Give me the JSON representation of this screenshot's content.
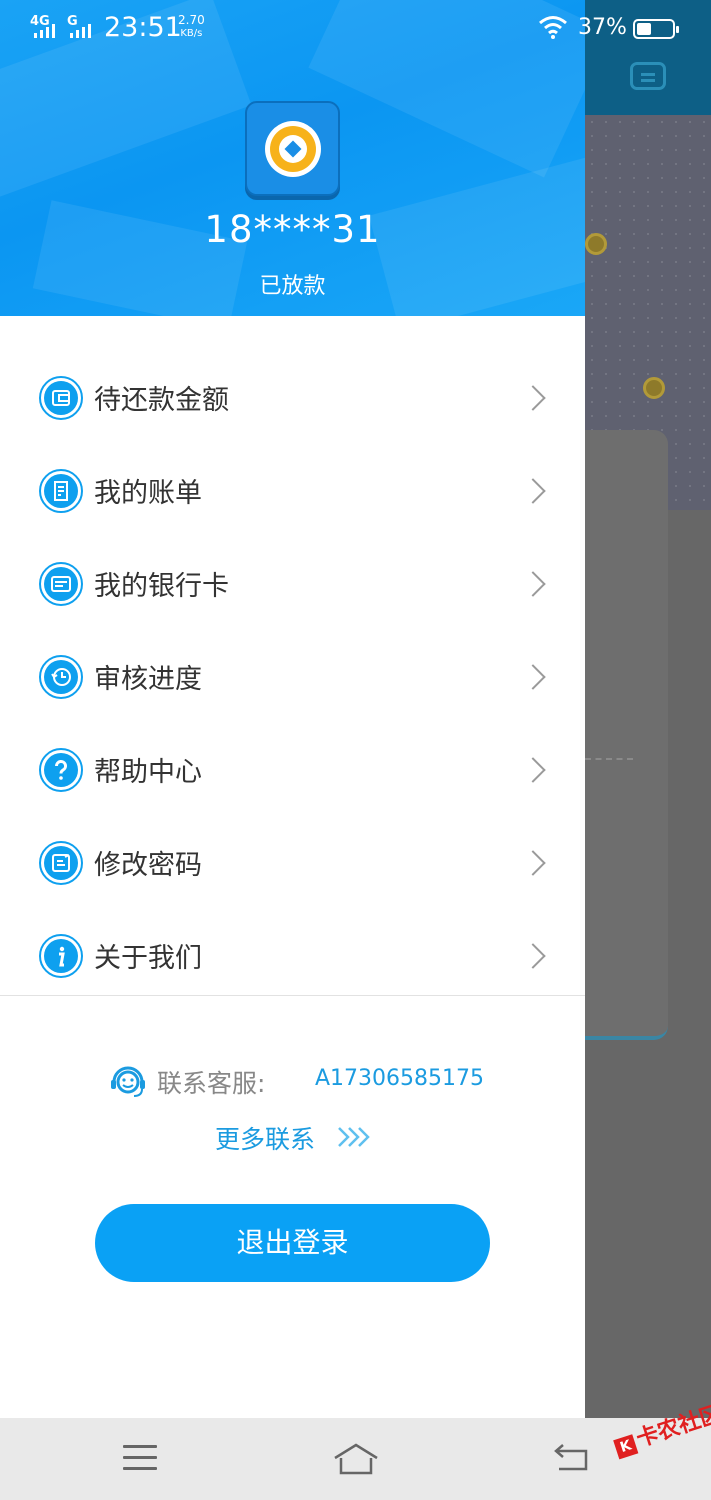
{
  "status_bar": {
    "network_1": "4G",
    "network_2": "G",
    "time": "23:51",
    "speed_value": "2.70",
    "speed_unit": "KB/s",
    "battery": "37%"
  },
  "profile": {
    "phone": "18****31",
    "status": "已放款"
  },
  "menu": {
    "items": [
      {
        "label": "待还款金额",
        "icon": "wallet-icon"
      },
      {
        "label": "我的账单",
        "icon": "bill-icon"
      },
      {
        "label": "我的银行卡",
        "icon": "bank-card-icon"
      },
      {
        "label": "审核进度",
        "icon": "history-icon"
      },
      {
        "label": "帮助中心",
        "icon": "help-icon"
      },
      {
        "label": "修改密码",
        "icon": "edit-password-icon"
      },
      {
        "label": "关于我们",
        "icon": "info-icon"
      }
    ]
  },
  "customer_service": {
    "label": "联系客服:",
    "value": "A17306585175",
    "more_label": "更多联系"
  },
  "logout": {
    "label": "退出登录"
  },
  "watermark": {
    "text": "卡农社区"
  },
  "colors": {
    "primary": "#0aa1f5",
    "header": "#1aa3f5",
    "link": "#1b9be0"
  }
}
